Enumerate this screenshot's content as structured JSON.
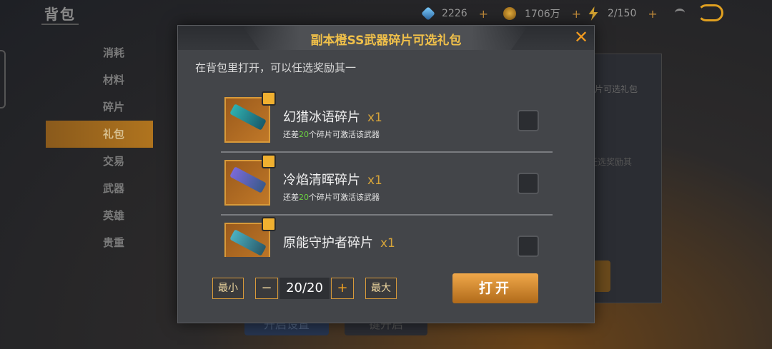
{
  "header": {
    "title": "背包",
    "gems": "2226",
    "coins": "1706万",
    "energy": "2/150",
    "plus": "+"
  },
  "sidebar": {
    "items": [
      {
        "label": "消耗"
      },
      {
        "label": "材料"
      },
      {
        "label": "碎片"
      },
      {
        "label": "礼包"
      },
      {
        "label": "交易"
      },
      {
        "label": "武器"
      },
      {
        "label": "英雄"
      },
      {
        "label": "贵重"
      }
    ],
    "active_index": 3
  },
  "background": {
    "side_text1": "碎片可选礼包",
    "side_text2": "任选奖励其",
    "bottom_left": "开启设置",
    "bottom_right": "键开启"
  },
  "modal": {
    "title": "副本橙SS武器碎片可选礼包",
    "close": "✕",
    "subtitle": "在背包里打开，可以任选奖励其一",
    "items": [
      {
        "name": "幻猎冰语碎片",
        "qty": "x1",
        "note_prefix": "还差",
        "note_num": "20",
        "note_suffix": "个碎片可激活该武器"
      },
      {
        "name": "冷焰清晖碎片",
        "qty": "x1",
        "note_prefix": "还差",
        "note_num": "20",
        "note_suffix": "个碎片可激活该武器"
      },
      {
        "name": "原能守护者碎片",
        "qty": "x1",
        "note_prefix": "",
        "note_num": "",
        "note_suffix": ""
      }
    ],
    "min_label": "最小",
    "minus_label": "−",
    "quantity": "20/20",
    "plus_label": "+",
    "max_label": "最大",
    "open_label": "打开"
  },
  "colors": {
    "accent": "#f0c04a",
    "active_tab": "#b0741e",
    "highlight_num": "#6ad040"
  }
}
